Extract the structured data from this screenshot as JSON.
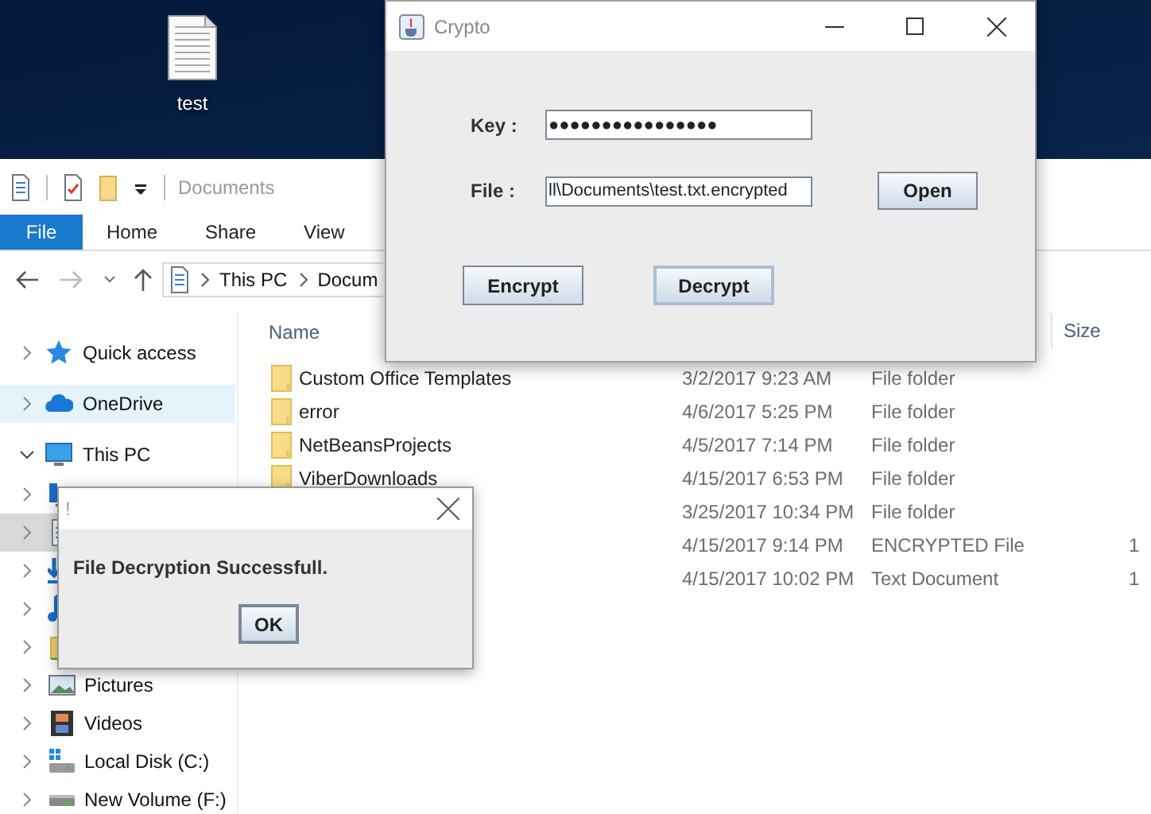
{
  "desktop": {
    "icons": [
      {
        "label": "test"
      }
    ]
  },
  "explorer": {
    "title": "Documents",
    "ribbon_tabs": [
      {
        "label": "File",
        "selected": true
      },
      {
        "label": "Home",
        "selected": false
      },
      {
        "label": "Share",
        "selected": false
      },
      {
        "label": "View",
        "selected": false
      }
    ],
    "address": [
      "This PC",
      "Docum"
    ],
    "nav": [
      {
        "label": "Quick access",
        "kind": "star",
        "expanded": false,
        "selected": false,
        "hovered": false
      },
      {
        "label": "OneDrive",
        "kind": "cloud",
        "expanded": false,
        "selected": false,
        "hovered": true
      },
      {
        "label": "This PC",
        "kind": "pc",
        "expanded": true,
        "selected": false,
        "hovered": false,
        "children": [
          {
            "kind": "desktop",
            "expanded": false,
            "selected": false,
            "hovered": false
          },
          {
            "kind": "document",
            "expanded": false,
            "selected": true,
            "hovered": false
          },
          {
            "kind": "download",
            "expanded": false,
            "selected": false,
            "hovered": false
          },
          {
            "kind": "music",
            "expanded": false,
            "selected": false,
            "hovered": false
          },
          {
            "kind": "folder",
            "expanded": false,
            "selected": false,
            "hovered": false
          },
          {
            "label": "Pictures",
            "kind": "pictures",
            "expanded": false,
            "selected": false,
            "hovered": false
          },
          {
            "label": "Videos",
            "kind": "videos",
            "expanded": false,
            "selected": false,
            "hovered": false
          },
          {
            "label": "Local Disk (C:)",
            "kind": "disk",
            "expanded": false,
            "selected": false,
            "hovered": false
          },
          {
            "label": "New Volume (F:)",
            "kind": "drive",
            "expanded": false,
            "selected": false,
            "hovered": false
          }
        ]
      }
    ],
    "columns": [
      "Name",
      "Size"
    ],
    "rows": [
      {
        "kind": "folder",
        "name": "Custom Office Templates",
        "date": "3/2/2017 9:23 AM",
        "type": "File folder"
      },
      {
        "kind": "folder",
        "name": "error",
        "date": "4/6/2017 5:25 PM",
        "type": "File folder"
      },
      {
        "kind": "folder",
        "name": "NetBeansProjects",
        "date": "4/5/2017 7:14 PM",
        "type": "File folder"
      },
      {
        "kind": "folder",
        "name": "ViberDownloads",
        "date": "4/15/2017 6:53 PM",
        "type": "File folder"
      },
      {
        "date": "3/25/2017 10:34 PM",
        "type": "File folder"
      },
      {
        "date": "4/15/2017 9:14 PM",
        "type": "ENCRYPTED File",
        "size": "1"
      },
      {
        "date": "4/15/2017 10:02 PM",
        "type": "Text Document",
        "size": "1"
      }
    ]
  },
  "crypto": {
    "title": "Crypto",
    "key": {
      "label": "Key :",
      "value": "●●●●●●●●●●●●●●●●"
    },
    "file": {
      "label": "File :",
      "value": "ll\\Documents\\test.txt.encrypted"
    },
    "open_button": {
      "label": "Open",
      "focused": false
    },
    "buttons": [
      {
        "label": "Encrypt",
        "focused": false
      },
      {
        "label": "Decrypt",
        "focused": true
      }
    ]
  },
  "dialog": {
    "title": "!",
    "message": "File Decryption Successfull.",
    "button": "OK"
  }
}
